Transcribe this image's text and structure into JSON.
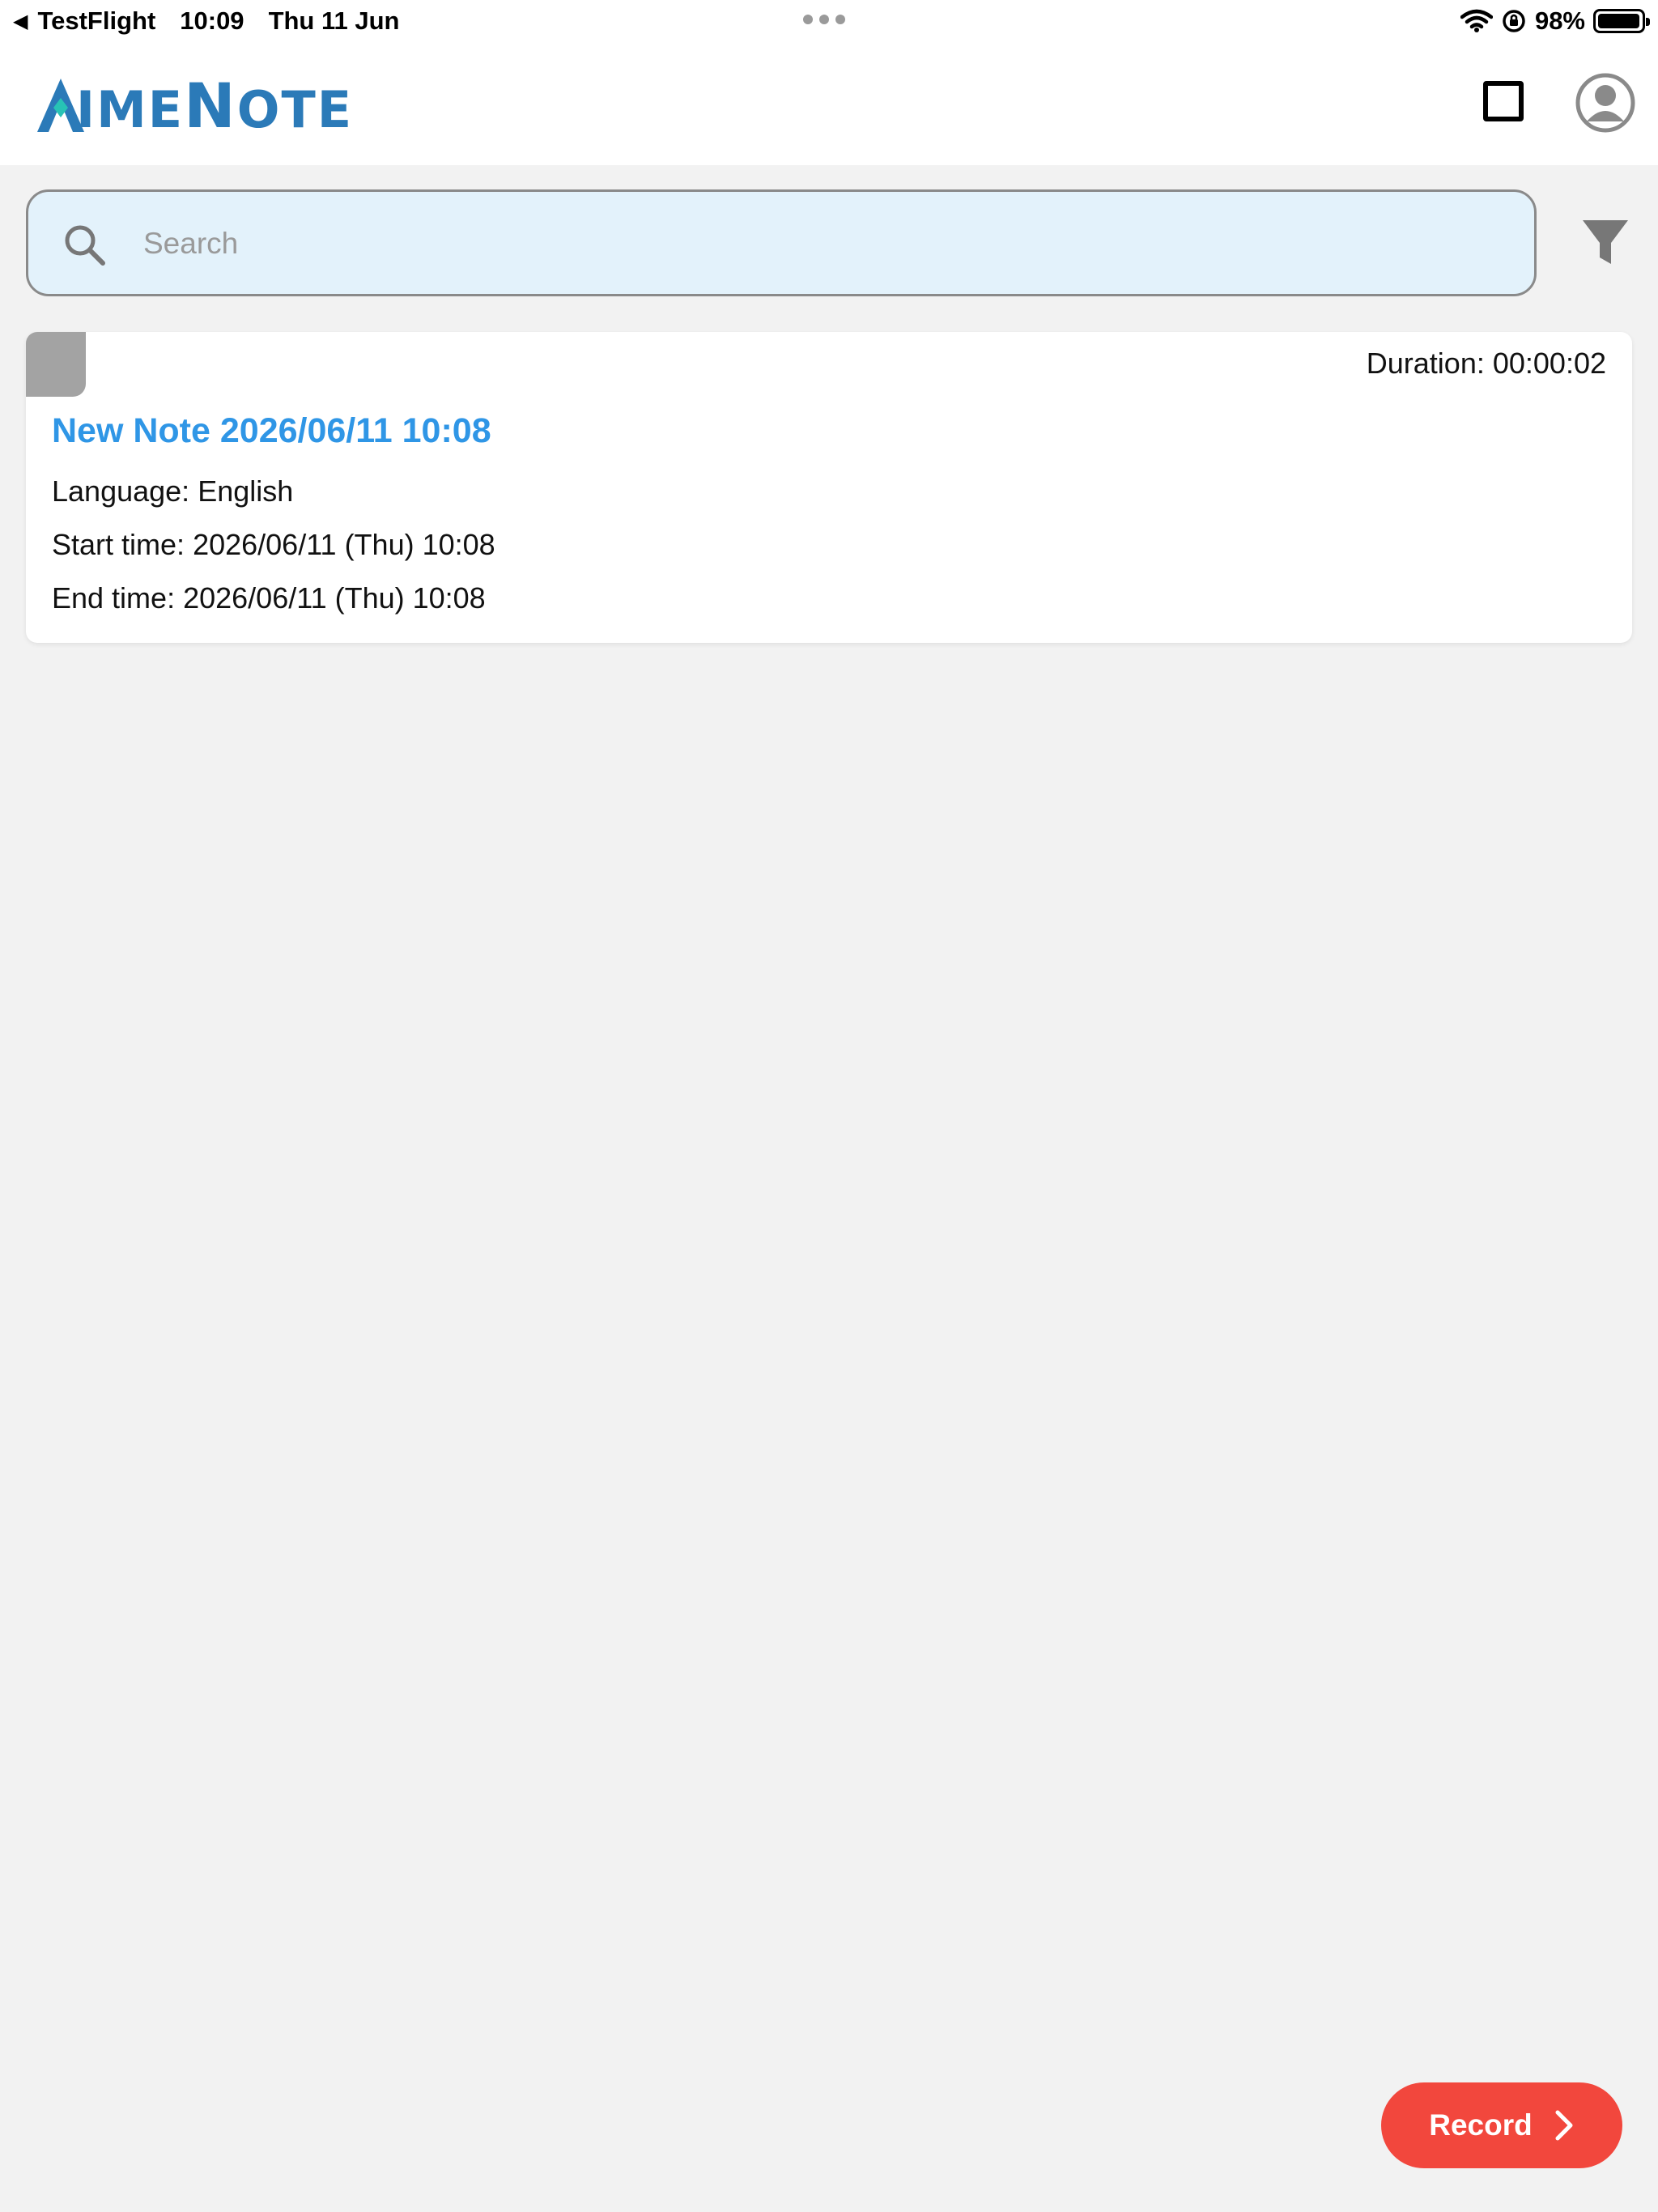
{
  "status_bar": {
    "back_arrow": "◀",
    "app_name": "TestFlight",
    "time": "10:09",
    "date": "Thu 11 Jun",
    "battery_percent": "98%",
    "battery_level": 0.98
  },
  "header": {
    "logo_text": "AIMENOTE",
    "stop_icon": "stop-square-icon",
    "profile_icon": "user-circle-icon"
  },
  "search": {
    "placeholder": "Search",
    "value": "",
    "filter_icon": "filter-icon"
  },
  "notes": [
    {
      "title": "New Note 2026/06/11 10:08",
      "duration_label": "Duration:",
      "duration": "00:00:02",
      "language_label": "Language:",
      "language": "English",
      "start_label": "Start time:",
      "start": "2026/06/11 (Thu) 10:08",
      "end_label": "End time:",
      "end": "2026/06/11 (Thu) 10:08"
    }
  ],
  "record_button": {
    "label": "Record",
    "icon": "chevron-right-icon"
  },
  "colors": {
    "accent": "#2f96e6",
    "logo": "#2b7ab8",
    "record": "#f2473d",
    "search_bg": "#e3f2fb",
    "background": "#f2f2f2"
  }
}
